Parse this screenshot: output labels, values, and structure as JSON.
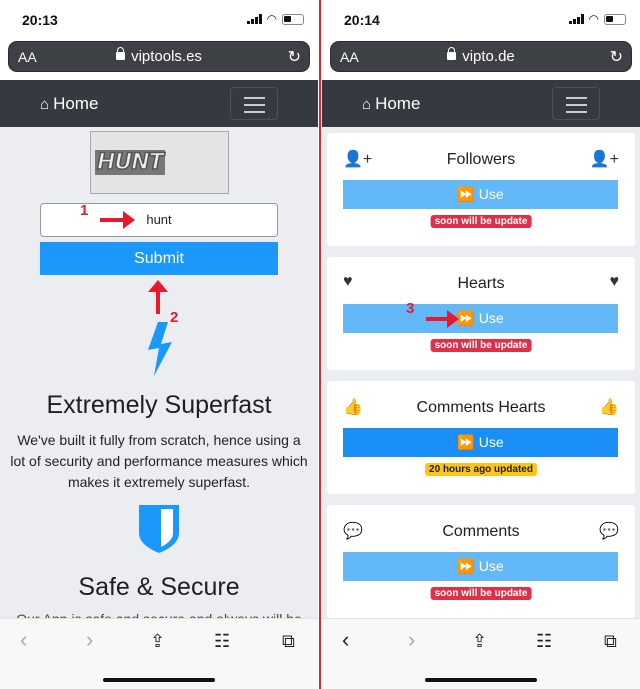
{
  "left": {
    "status": {
      "time": "20:13"
    },
    "browser": {
      "text_size": "AA",
      "url": "viptools.es"
    },
    "navbar": {
      "home_label": "Home"
    },
    "captcha": {
      "text": "HUNT"
    },
    "code_input": {
      "value": "hunt"
    },
    "submit_label": "Submit",
    "annotations": [
      "1",
      "2"
    ],
    "feature1": {
      "title": "Extremely Superfast",
      "text": "We've built it fully from scratch, hence using a lot of security and performance measures which makes it extremely superfast."
    },
    "feature2": {
      "title": "Safe & Secure",
      "text": "Our App is safe and secure and always will be"
    }
  },
  "right": {
    "status": {
      "time": "20:14"
    },
    "browser": {
      "text_size": "AA",
      "url": "vipto.de"
    },
    "navbar": {
      "home_label": "Home"
    },
    "annotation": "3",
    "cards": [
      {
        "title": "Followers",
        "icon": "user-plus-icon",
        "button": "Use",
        "badge": "soon will be update",
        "badge_color": "#de3048",
        "active": false
      },
      {
        "title": "Hearts",
        "icon": "heart-icon",
        "button": "Use",
        "badge": "soon will be update",
        "badge_color": "#de3048",
        "active": false
      },
      {
        "title": "Comments Hearts",
        "icon": "thumbs-up-icon",
        "button": "Use",
        "badge": "20 hours ago updated",
        "badge_color": "#ffc31a",
        "active": true
      },
      {
        "title": "Comments",
        "icon": "comment-icon",
        "button": "Use",
        "badge": "soon will be update",
        "badge_color": "#de3048",
        "active": false
      }
    ]
  },
  "colors": {
    "navbar": "#343a40",
    "submit": "#1a98fc",
    "use_inactive": "#63b8f8",
    "use_active": "#1a8ff8",
    "annotation": "#e8192c"
  }
}
